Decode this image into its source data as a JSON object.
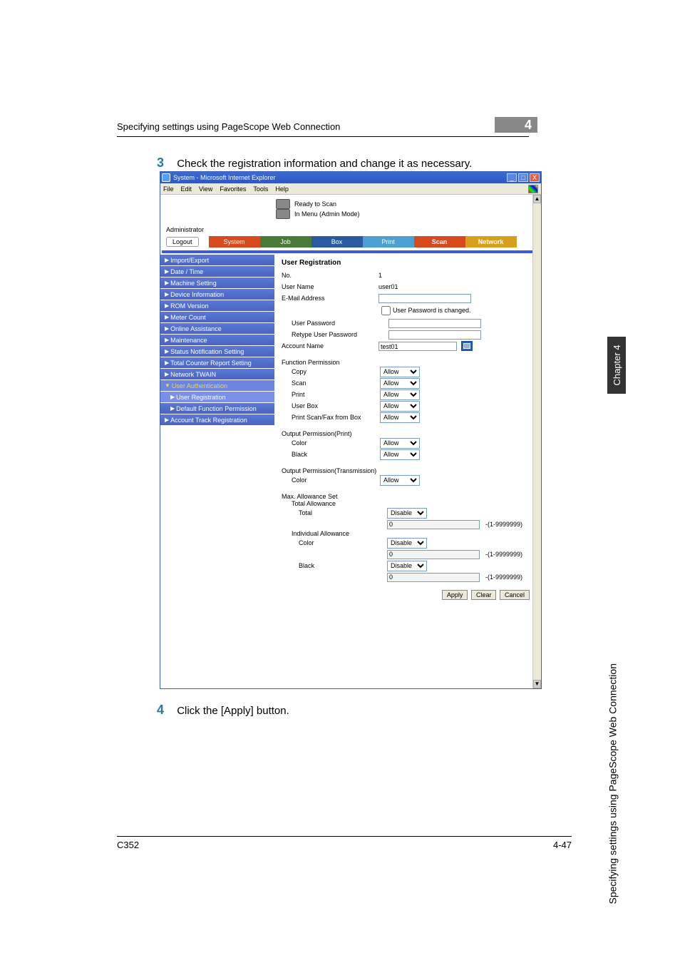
{
  "page": {
    "chapter_badge": "4",
    "header_title": "Specifying settings using PageScope Web Connection",
    "side_chapter": "Chapter 4",
    "side_vertical": "Specifying settings using PageScope Web Connection",
    "footer_left": "C352",
    "footer_right": "4-47"
  },
  "steps": {
    "s3_num": "3",
    "s3_text": "Check the registration information and change it as necessary.",
    "s4_num": "4",
    "s4_text": "Click the [Apply] button."
  },
  "browser": {
    "title": "System - Microsoft Internet Explorer",
    "menu": [
      "File",
      "Edit",
      "View",
      "Favorites",
      "Tools",
      "Help"
    ],
    "winbtns": {
      "min": "_",
      "max": "□",
      "close": "X"
    }
  },
  "status": {
    "line1": "Ready to Scan",
    "line2": "In Menu (Admin Mode)",
    "admin": "Administrator",
    "logout": "Logout"
  },
  "tabs": {
    "system": "System",
    "job": "Job",
    "box": "Box",
    "print": "Print",
    "scan": "Scan",
    "network": "Network"
  },
  "sidebar": {
    "items": [
      "Import/Export",
      "Date / Time",
      "Machine Setting",
      "Device Information",
      "ROM Version",
      "Meter Count",
      "Online Assistance",
      "Maintenance",
      "Status Notification Setting",
      "Total Counter Report Setting",
      "Network TWAIN",
      "User Authentication",
      "User Registration",
      "Default Function Permission",
      "Account Track Registration"
    ],
    "prefix_tri": "▶",
    "prefix_down": "▼"
  },
  "form": {
    "heading": "User Registration",
    "no_lbl": "No.",
    "no_val": "1",
    "username_lbl": "User Name",
    "username_val": "user01",
    "email_lbl": "E-Mail Address",
    "email_val": "",
    "chk_lbl": "User Password is changed.",
    "pwd_lbl": "User Password",
    "repwd_lbl": "Retype User Password",
    "acct_lbl": "Account Name",
    "acct_val": "test01",
    "funcperm_h": "Function Permission",
    "rows_fp": [
      {
        "lbl": "Copy",
        "val": "Allow"
      },
      {
        "lbl": "Scan",
        "val": "Allow"
      },
      {
        "lbl": "Print",
        "val": "Allow"
      },
      {
        "lbl": "User Box",
        "val": "Allow"
      },
      {
        "lbl": "Print Scan/Fax from Box",
        "val": "Allow"
      }
    ],
    "opp_h": "Output Permission(Print)",
    "rows_opp": [
      {
        "lbl": "Color",
        "val": "Allow"
      },
      {
        "lbl": "Black",
        "val": "Allow"
      }
    ],
    "opt_h": "Output Permission(Transmission)",
    "rows_opt": [
      {
        "lbl": "Color",
        "val": "Allow"
      }
    ],
    "max_h": "Max. Allowance Set",
    "total_h": "Total Allowance",
    "total_row": {
      "lbl": "Total",
      "sel": "Disable",
      "num": "0",
      "range": "-(1-9999999)"
    },
    "indiv_h": "Individual Allowance",
    "indiv_rows": [
      {
        "lbl": "Color",
        "sel": "Disable",
        "num": "0",
        "range": "-(1-9999999)"
      },
      {
        "lbl": "Black",
        "sel": "Disable",
        "num": "0",
        "range": "-(1-9999999)"
      }
    ],
    "btn_apply": "Apply",
    "btn_clear": "Clear",
    "btn_cancel": "Cancel"
  }
}
